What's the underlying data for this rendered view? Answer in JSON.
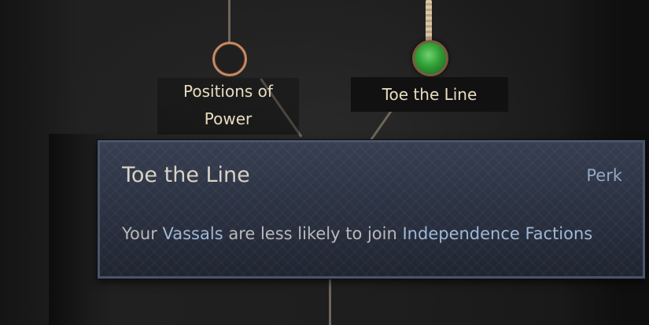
{
  "perk_tree": {
    "nodes": [
      {
        "label": "Positions of\nPower",
        "state": "unselected"
      },
      {
        "label": "Toe the Line",
        "state": "selected"
      }
    ]
  },
  "tooltip": {
    "title": "Toe the Line",
    "type": "Perk",
    "desc_part1": "Your ",
    "desc_kw1": "Vassals",
    "desc_part2": " are less likely to join ",
    "desc_kw2": "Independence Factions"
  },
  "colors": {
    "keyword": "#9fb8d6",
    "selected_gem": "#2f9e35",
    "node_ring": "#c68a63"
  }
}
